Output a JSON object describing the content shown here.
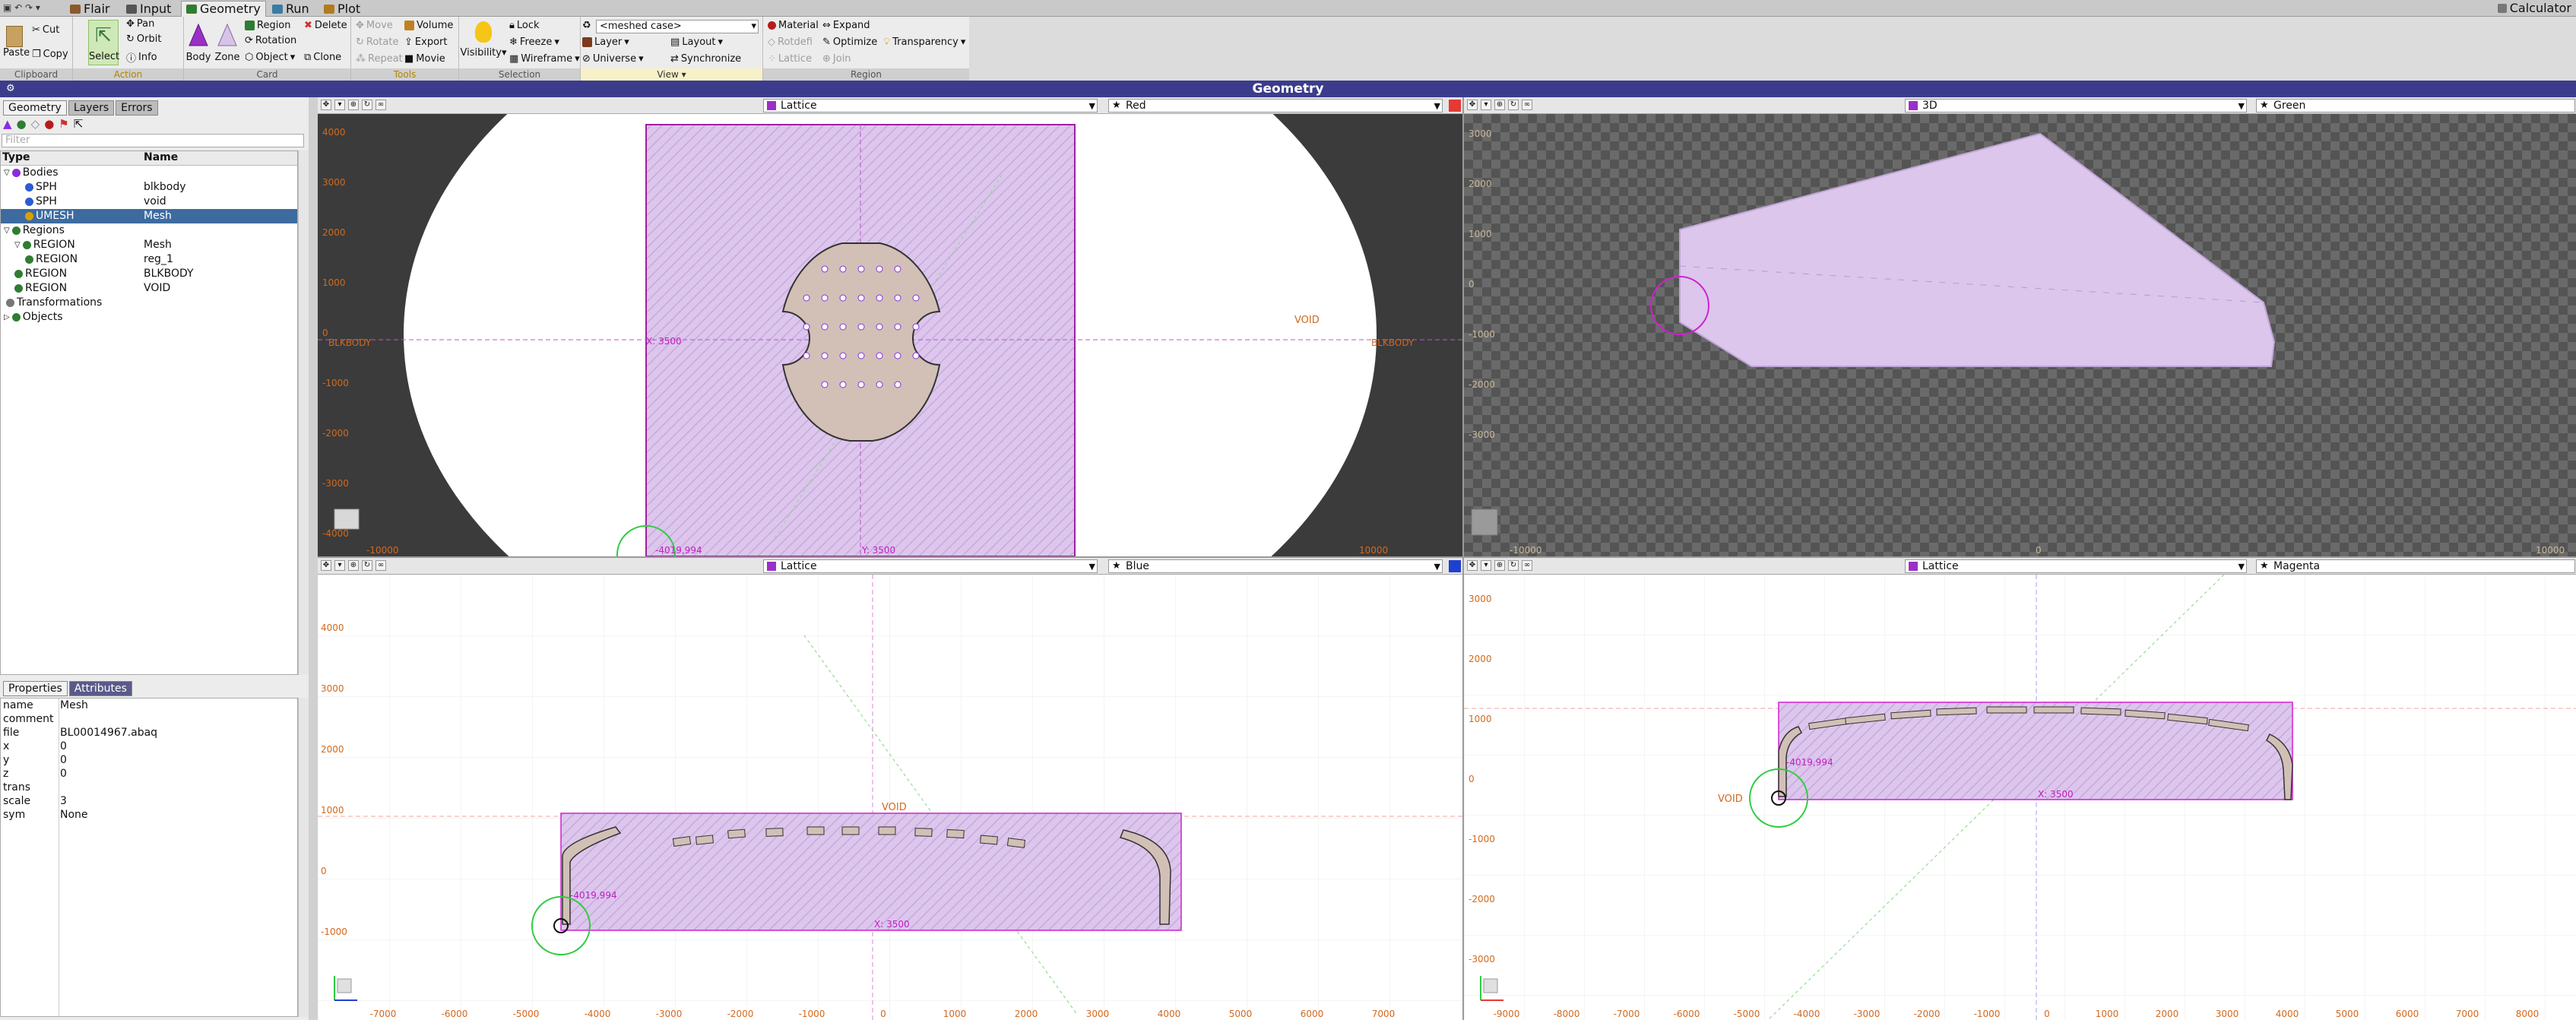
{
  "quick_access": "▣ ↶ ↷ ▾",
  "tabs": [
    {
      "label": "Flair",
      "color": "#8b5a2b"
    },
    {
      "label": "Input",
      "color": "#444"
    },
    {
      "label": "Geometry",
      "color": "#2e7d32"
    },
    {
      "label": "Run",
      "color": "#3a7ca5"
    },
    {
      "label": "Plot",
      "color": "#b47a1e"
    }
  ],
  "calculator_label": "Calculator",
  "ribbon": {
    "clipboard": {
      "paste": "Paste",
      "cut": "Cut",
      "copy": "Copy",
      "label": "Clipboard"
    },
    "action": {
      "select": "Select",
      "pan": "Pan",
      "orbit": "Orbit",
      "info": "Info",
      "label": "Action"
    },
    "card": {
      "body": "Body",
      "zone": "Zone",
      "region": "Region",
      "rotation": "Rotation",
      "object": "Object",
      "delete": "Delete",
      "clone": "Clone",
      "label": "Card"
    },
    "tools": {
      "move": "Move",
      "rotate": "Rotate",
      "repeat": "Repeat",
      "volume": "Volume",
      "export": "Export",
      "movie": "Movie",
      "label": "Tools"
    },
    "selection": {
      "visibility": "Visibility",
      "lock": "Lock",
      "freeze": "Freeze",
      "wireframe": "Wireframe",
      "label": "Selection"
    },
    "view": {
      "case": "<meshed case>",
      "layer": "Layer",
      "layout": "Layout",
      "universe": "Universe",
      "synchronize": "Synchronize",
      "label": "View"
    },
    "region": {
      "material": "Material",
      "expand": "Expand",
      "rotdefi": "Rotdefi",
      "optimize": "Optimize",
      "transparency": "Transparency",
      "lattice": "Lattice",
      "join": "Join",
      "label": "Region"
    }
  },
  "title": "Geometry",
  "left_tabs": [
    "Geometry",
    "Layers",
    "Errors"
  ],
  "filter_placeholder": "Filter",
  "tree": {
    "col_type": "Type",
    "col_name": "Name",
    "rows": [
      {
        "type": "Bodies",
        "name": "",
        "indent": 0,
        "icon": "#8a2be2"
      },
      {
        "type": "SPH",
        "name": "blkbody",
        "indent": 2,
        "icon": "#2d5bd6"
      },
      {
        "type": "SPH",
        "name": "void",
        "indent": 2,
        "icon": "#2d5bd6"
      },
      {
        "type": "UMESH",
        "name": "Mesh",
        "indent": 2,
        "icon": "#d9a100",
        "selected": true
      },
      {
        "type": "Regions",
        "name": "",
        "indent": 0,
        "icon": "#2e7d32"
      },
      {
        "type": "REGION",
        "name": "Mesh",
        "indent": 1,
        "icon": "#2e7d32"
      },
      {
        "type": "REGION",
        "name": "reg_1",
        "indent": 2,
        "icon": "#2e7d32"
      },
      {
        "type": "REGION",
        "name": "BLKBODY",
        "indent": 1,
        "icon": "#2e7d32"
      },
      {
        "type": "REGION",
        "name": "VOID",
        "indent": 1,
        "icon": "#2e7d32"
      },
      {
        "type": "Transformations",
        "name": "",
        "indent": 0,
        "icon": "#777"
      },
      {
        "type": "Objects",
        "name": "",
        "indent": 0,
        "icon": "#2e7d32"
      }
    ]
  },
  "prop_tabs": [
    "Properties",
    "Attributes"
  ],
  "properties": [
    {
      "key": "name",
      "value": "Mesh"
    },
    {
      "key": "comment",
      "value": ""
    },
    {
      "key": "file",
      "value": "BL00014967.abaq"
    },
    {
      "key": "x",
      "value": "0"
    },
    {
      "key": "y",
      "value": "0"
    },
    {
      "key": "z",
      "value": "0"
    },
    {
      "key": "trans",
      "value": ""
    },
    {
      "key": "scale",
      "value": "3"
    },
    {
      "key": "sym",
      "value": "None"
    }
  ],
  "viewports": {
    "red": {
      "mode": "Lattice",
      "name": "Red",
      "color": "#e53935",
      "y_ticks": [
        "4000",
        "3000",
        "2000",
        "1000",
        "0",
        "-1000",
        "-2000",
        "-3000",
        "-4000"
      ],
      "labels": {
        "void": "VOID",
        "blkbody_left": "BLKBODY",
        "blkbody_right": "BLKBODY",
        "x_marker": "X: 3500",
        "y_marker": "Y: 3500",
        "mesh_corner": "-4019,994",
        "bottom_left": "-10000",
        "bottom_right": "10000"
      }
    },
    "green": {
      "mode": "3D",
      "name": "Green",
      "color": "#43a047",
      "y_ticks": [
        "3000",
        "2000",
        "1000",
        "0",
        "-1000",
        "-2000",
        "-3000"
      ],
      "labels": {
        "bottom_left": "-10000",
        "center": "0",
        "bottom_right": "10000"
      }
    },
    "blue": {
      "mode": "Lattice",
      "name": "Blue",
      "color": "#1e40d0",
      "x_ticks": [
        "-7000",
        "-6000",
        "-5000",
        "-4000",
        "-3000",
        "-2000",
        "-1000",
        "0",
        "1000",
        "2000",
        "3000",
        "4000",
        "5000",
        "6000",
        "7000"
      ],
      "y_ticks": [
        "4000",
        "3000",
        "2000",
        "1000",
        "0",
        "-1000"
      ],
      "labels": {
        "void": "VOID",
        "mesh_corner": "-4019,994",
        "x_marker": "X: 3500"
      }
    },
    "magenta": {
      "mode": "Lattice",
      "name": "Magenta",
      "color": "#d81b9b",
      "x_ticks": [
        "-9000",
        "-8000",
        "-7000",
        "-6000",
        "-5000",
        "-4000",
        "-3000",
        "-2000",
        "-1000",
        "0",
        "1000",
        "2000",
        "3000",
        "4000",
        "5000",
        "6000",
        "7000",
        "8000"
      ],
      "y_ticks": [
        "3000",
        "2000",
        "1000",
        "0",
        "-1000",
        "-2000",
        "-3000"
      ],
      "labels": {
        "void": "VOID",
        "mesh_corner": "-4019,994",
        "x_marker": "X: 3500"
      }
    }
  }
}
